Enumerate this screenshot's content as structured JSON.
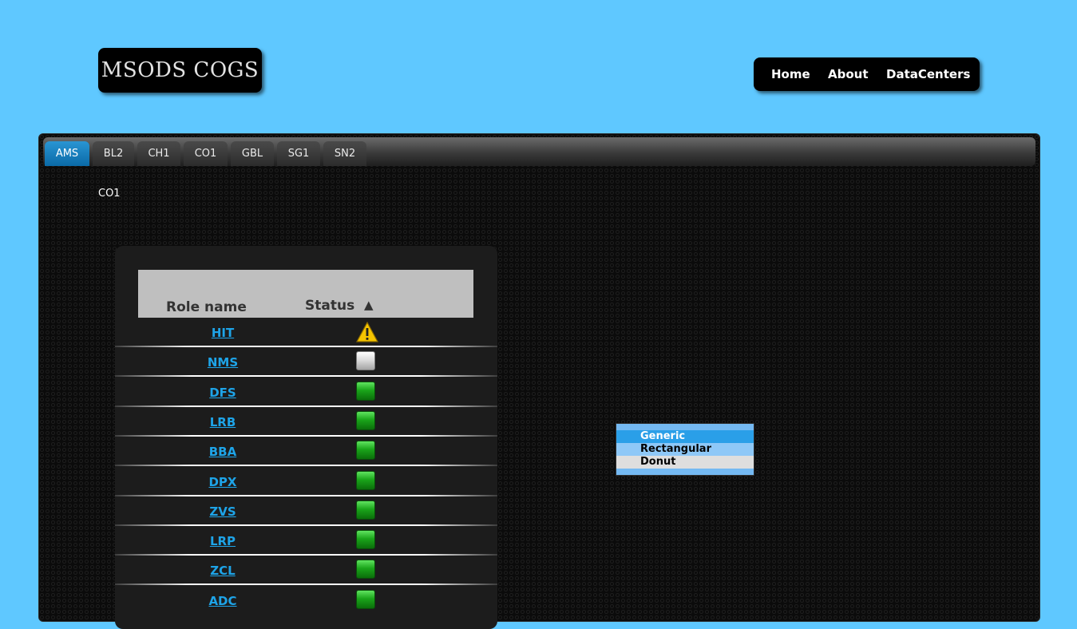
{
  "header": {
    "logo": "MSODS COGS",
    "nav": [
      "Home",
      "About",
      "DataCenters"
    ]
  },
  "tabs": {
    "items": [
      "AMS",
      "BL2",
      "CH1",
      "CO1",
      "GBL",
      "SG1",
      "SN2"
    ],
    "active": "AMS"
  },
  "datacenter_label": "CO1",
  "table": {
    "col_role": "Role name",
    "col_status": "Status",
    "sort_indicator": "▲",
    "rows": [
      {
        "role": "HIT",
        "status": "warning"
      },
      {
        "role": "NMS",
        "status": "unknown"
      },
      {
        "role": "DFS",
        "status": "ok"
      },
      {
        "role": "LRB",
        "status": "ok"
      },
      {
        "role": "BBA",
        "status": "ok"
      },
      {
        "role": "DPX",
        "status": "ok"
      },
      {
        "role": "ZVS",
        "status": "ok"
      },
      {
        "role": "LRP",
        "status": "ok"
      },
      {
        "role": "ZCL",
        "status": "ok"
      },
      {
        "role": "ADC",
        "status": "ok"
      }
    ]
  },
  "chart_type_list": {
    "options": [
      "Generic",
      "Rectangular",
      "Donut"
    ],
    "selected": "Generic"
  },
  "colors": {
    "page_bg": "#5fc8ff",
    "active_tab": "#1a7fc0",
    "link": "#1ea4e8",
    "status_ok": "#1aa51a",
    "status_warning": "#f5c400",
    "status_unknown": "#d8d8d8"
  }
}
